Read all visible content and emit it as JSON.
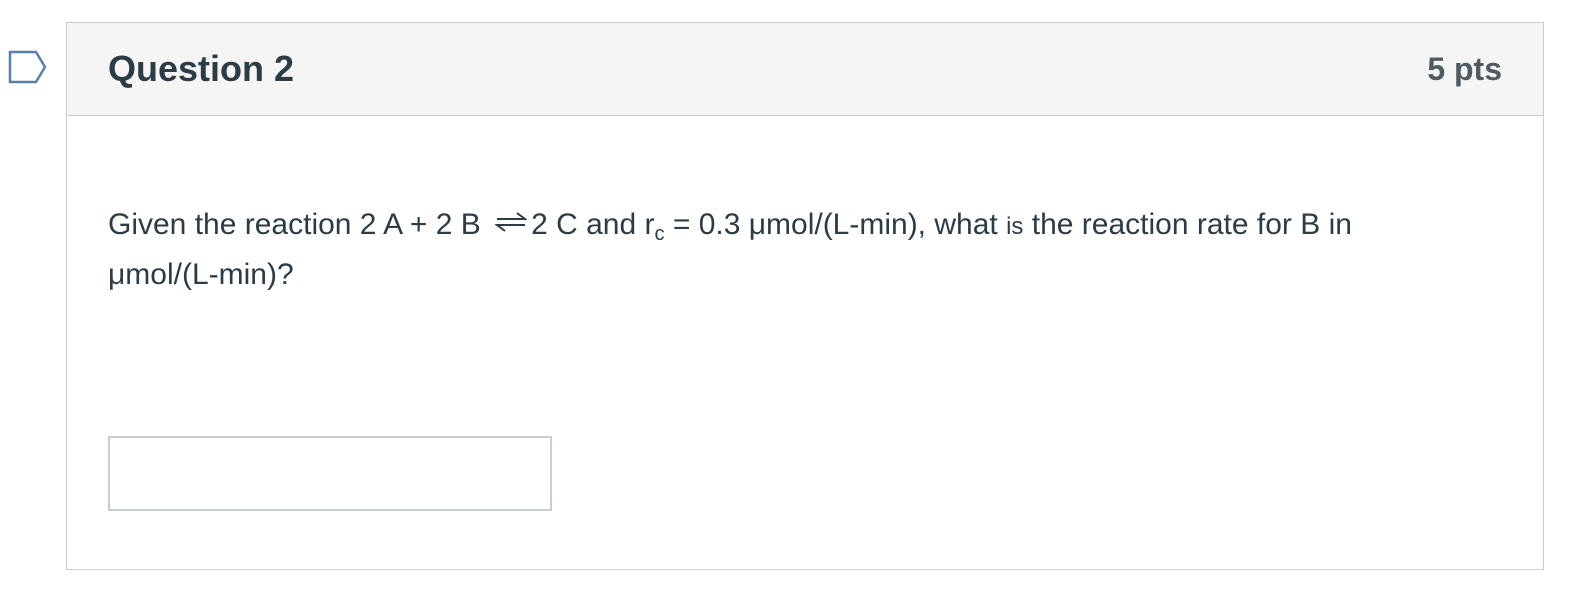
{
  "question": {
    "title": "Question 2",
    "points": "5 pts",
    "text": {
      "part1": "Given the reaction 2 A + 2 B",
      "part2": "2 C and r",
      "subscript": "c",
      "part3": " = 0.3 μmol/(L-min), what ",
      "small_word": "is",
      "part4": " the reaction rate for B in",
      "line2": "μmol/(L-min)?"
    },
    "answer": {
      "value": "",
      "placeholder": ""
    }
  },
  "icons": {
    "flag": "bookmark-flag-icon",
    "equilibrium": "equilibrium-arrows-icon"
  },
  "colors": {
    "text": "#2d3b45",
    "points": "#4f5a61",
    "header_bg": "#f5f5f5",
    "border": "#c7cdd1",
    "flag_stroke": "#5b7fa6"
  }
}
